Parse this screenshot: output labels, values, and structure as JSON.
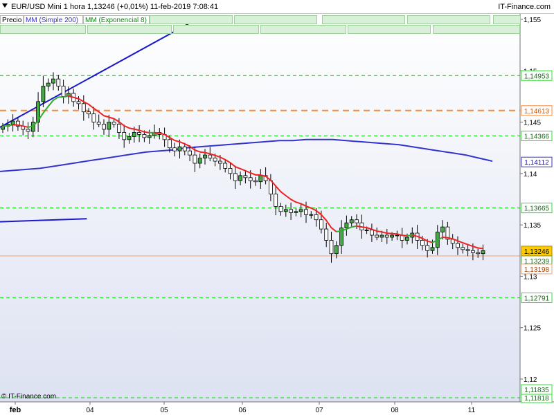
{
  "header": {
    "title": "EUR/USD Mini    1 hora    1,13246 (+0,01%)    11-feb-2019 7:08:41",
    "brand": "IT-Finance.com"
  },
  "legend": {
    "price": "Precio",
    "sma": "MM (Simple 200)",
    "ema": "MM (Exponencial 8)"
  },
  "footer": {
    "credit": "© IT-Finance.com"
  },
  "colors": {
    "background_top": "#ffffff",
    "background_bottom": "#dde2f2",
    "candle_up": "#44aa44",
    "candle_down": "#ffffff",
    "sma": "#3333cc",
    "ema_up": "#33aa33",
    "ema_down": "#ee2222",
    "trendline": "#1a1acc",
    "support_line": "#33dd33",
    "resistance_line": "#ff8833",
    "last_price": "#ffcc00"
  },
  "chart_data": {
    "type": "candlestick",
    "instrument": "EUR/USD Mini",
    "timeframe": "1 hora",
    "last": 1.13246,
    "change": "+0,01%",
    "timestamp": "11-feb-2019 7:08:41",
    "ylim": [
      1.1175,
      1.1565
    ],
    "y_ticks": [
      "1,155",
      "1,15",
      "1,145",
      "1,14",
      "1,135",
      "1,13",
      "1,125",
      "1,12"
    ],
    "x_ticks": [
      "feb",
      "04",
      "05",
      "06",
      "07",
      "08",
      "11"
    ],
    "horizontal_lines": [
      {
        "value": 1.14953,
        "label": "1,14953",
        "style": "support"
      },
      {
        "value": 1.14613,
        "label": "1,14613",
        "style": "resistance"
      },
      {
        "value": 1.14366,
        "label": "1,14366",
        "style": "support"
      },
      {
        "value": 1.13665,
        "label": "1,13665",
        "style": "support"
      },
      {
        "value": 1.12791,
        "label": "1,12791",
        "style": "support"
      },
      {
        "value": 1.11818,
        "label": "1,11818",
        "style": "support"
      }
    ],
    "price_labels": [
      {
        "value": 1.14112,
        "label": "1,14112",
        "kind": "sma"
      },
      {
        "value": 1.13246,
        "label": "1,13246",
        "kind": "last"
      },
      {
        "value": 1.13239,
        "label": "1,13239",
        "kind": "ema"
      },
      {
        "value": 1.13198,
        "label": "1,13198",
        "kind": "ref"
      },
      {
        "value": 1.11835,
        "label": "1,11835",
        "kind": "ref"
      }
    ],
    "reference_line": 1.13198,
    "trendlines": [
      {
        "x": [
          0.0,
          0.385
        ],
        "y": [
          1.1445,
          1.1552
        ]
      },
      {
        "x": [
          0.0,
          0.167
        ],
        "y": [
          1.1353,
          1.1356
        ]
      }
    ],
    "close": [
      1.1446,
      1.1448,
      1.1451,
      1.1446,
      1.1443,
      1.1441,
      1.145,
      1.147,
      1.1485,
      1.1488,
      1.1492,
      1.1485,
      1.1475,
      1.1478,
      1.147,
      1.1468,
      1.146,
      1.1458,
      1.145,
      1.1448,
      1.1443,
      1.145,
      1.1448,
      1.144,
      1.1433,
      1.1436,
      1.144,
      1.1438,
      1.1435,
      1.1437,
      1.144,
      1.1438,
      1.1433,
      1.1425,
      1.1422,
      1.1426,
      1.1422,
      1.1418,
      1.141,
      1.1415,
      1.1418,
      1.1415,
      1.1412,
      1.141,
      1.1405,
      1.14,
      1.1393,
      1.1398,
      1.1396,
      1.1393,
      1.1392,
      1.1398,
      1.1393,
      1.138,
      1.1368,
      1.1363,
      1.1365,
      1.1362,
      1.1363,
      1.1365,
      1.136,
      1.136,
      1.1355,
      1.1346,
      1.1335,
      1.1322,
      1.133,
      1.1347,
      1.1352,
      1.1355,
      1.1352,
      1.1345,
      1.1345,
      1.134,
      1.1338,
      1.134,
      1.1338,
      1.134,
      1.134,
      1.1335,
      1.1338,
      1.1342,
      1.1335,
      1.133,
      1.1325,
      1.1328,
      1.1343,
      1.1348,
      1.1336,
      1.1332,
      1.1328,
      1.1326,
      1.1325,
      1.1323,
      1.1322,
      1.1325
    ],
    "series": [
      {
        "name": "MM (Simple 200)",
        "values": [
          1.1402,
          1.1403,
          1.1404,
          1.1405,
          1.1407,
          1.1409,
          1.1411,
          1.1413,
          1.1415,
          1.1417,
          1.1419,
          1.1421,
          1.1422,
          1.1423,
          1.1425,
          1.1426,
          1.1427,
          1.1428,
          1.1429,
          1.143,
          1.1431,
          1.1432,
          1.1432,
          1.1433,
          1.1433,
          1.1433,
          1.1432,
          1.1431,
          1.143,
          1.1429,
          1.1428,
          1.1426,
          1.1424,
          1.1422,
          1.142,
          1.1418,
          1.1415,
          1.1412
        ]
      },
      {
        "name": "MM (Exponencial 8)",
        "values": "EMA(8) of close"
      }
    ]
  }
}
